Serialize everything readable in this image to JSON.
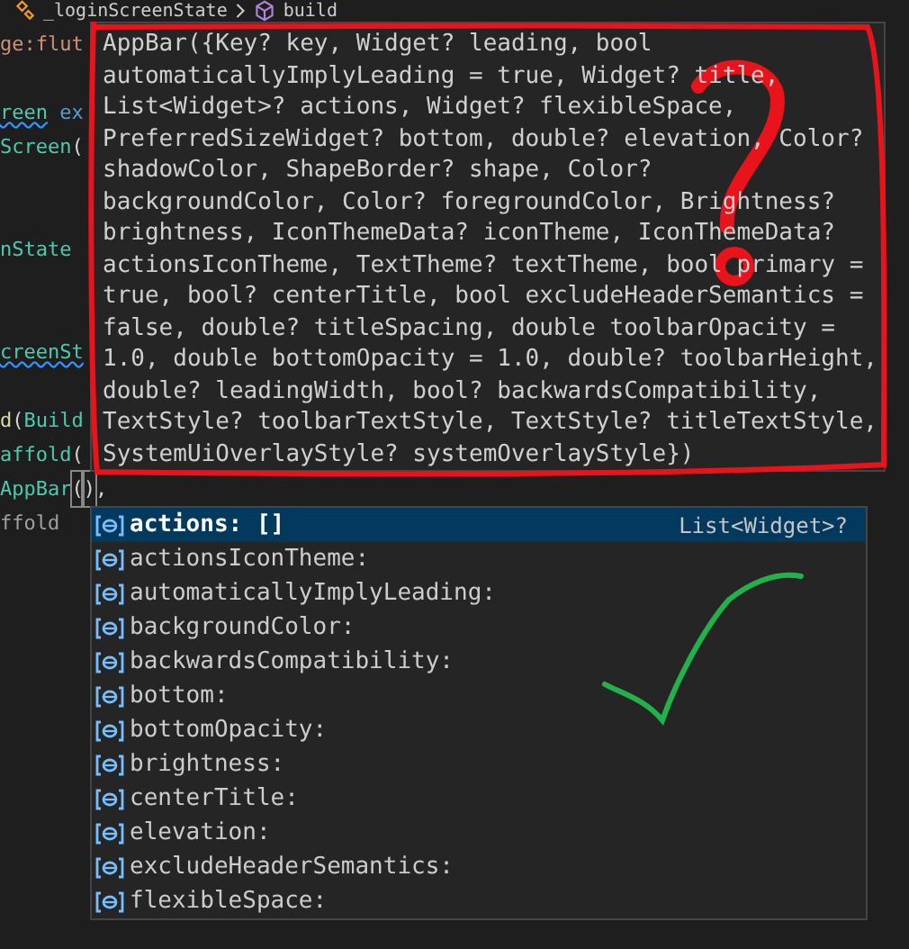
{
  "breadcrumb": [
    {
      "kind": "class",
      "label": "_loginScreenState"
    },
    {
      "kind": "method",
      "label": "build"
    }
  ],
  "code_lines": [
    [
      {
        "kind": "string",
        "text": "ge:flut"
      }
    ],
    [
      {
        "kind": "type-error",
        "text": "reen"
      },
      {
        "kind": "keyword",
        "text": "ex"
      }
    ],
    [
      {
        "kind": "type",
        "text": "Screen"
      },
      {
        "kind": "plain",
        "text": "("
      }
    ],
    [
      {
        "kind": "type",
        "text": "nState"
      }
    ],
    [
      {
        "kind": "type-error",
        "text": "creenSt"
      }
    ],
    [
      {
        "kind": "function",
        "text": "d"
      },
      {
        "kind": "plain",
        "text": "("
      },
      {
        "kind": "type",
        "text": "Build"
      }
    ],
    [
      {
        "kind": "type",
        "text": "affold"
      },
      {
        "kind": "plain",
        "text": "("
      }
    ],
    [
      {
        "kind": "type",
        "text": "AppBar"
      },
      {
        "kind": "bracket",
        "text": "("
      },
      {
        "kind": "bracket",
        "text": ")"
      },
      {
        "kind": "plain",
        "text": ","
      }
    ],
    [
      {
        "kind": "muted",
        "text": "ffold"
      }
    ]
  ],
  "signature_lines": [
    "AppBar({Key? key, Widget? leading, bool",
    "automaticallyImplyLeading = true, Widget? title,",
    "List<Widget>? actions, Widget? flexibleSpace,",
    "PreferredSizeWidget? bottom, double? elevation, Color?",
    "shadowColor, ShapeBorder? shape, Color?",
    "backgroundColor, Color? foregroundColor, Brightness?",
    "brightness, IconThemeData? iconTheme, IconThemeData?",
    "actionsIconTheme, TextTheme? textTheme, bool primary =",
    "true, bool? centerTitle, bool excludeHeaderSemantics =",
    "false, double? titleSpacing, double toolbarOpacity =",
    "1.0, double bottomOpacity = 1.0, double? toolbarHeight,",
    "double? leadingWidth, bool? backwardsCompatibility,",
    "TextStyle? toolbarTextStyle, TextStyle? titleTextStyle,",
    "SystemUiOverlayStyle? systemOverlayStyle})"
  ],
  "suggestions": [
    {
      "label": "actions: []",
      "detail": "List<Widget>?",
      "selected": true
    },
    {
      "label": "actionsIconTheme:",
      "selected": false
    },
    {
      "label": "automaticallyImplyLeading:",
      "selected": false
    },
    {
      "label": "backgroundColor:",
      "selected": false
    },
    {
      "label": "backwardsCompatibility:",
      "selected": false
    },
    {
      "label": "bottom:",
      "selected": false
    },
    {
      "label": "bottomOpacity:",
      "selected": false
    },
    {
      "label": "brightness:",
      "selected": false
    },
    {
      "label": "centerTitle:",
      "selected": false
    },
    {
      "label": "elevation:",
      "selected": false
    },
    {
      "label": "excludeHeaderSemantics:",
      "selected": false
    },
    {
      "label": "flexibleSpace:",
      "selected": false
    }
  ]
}
